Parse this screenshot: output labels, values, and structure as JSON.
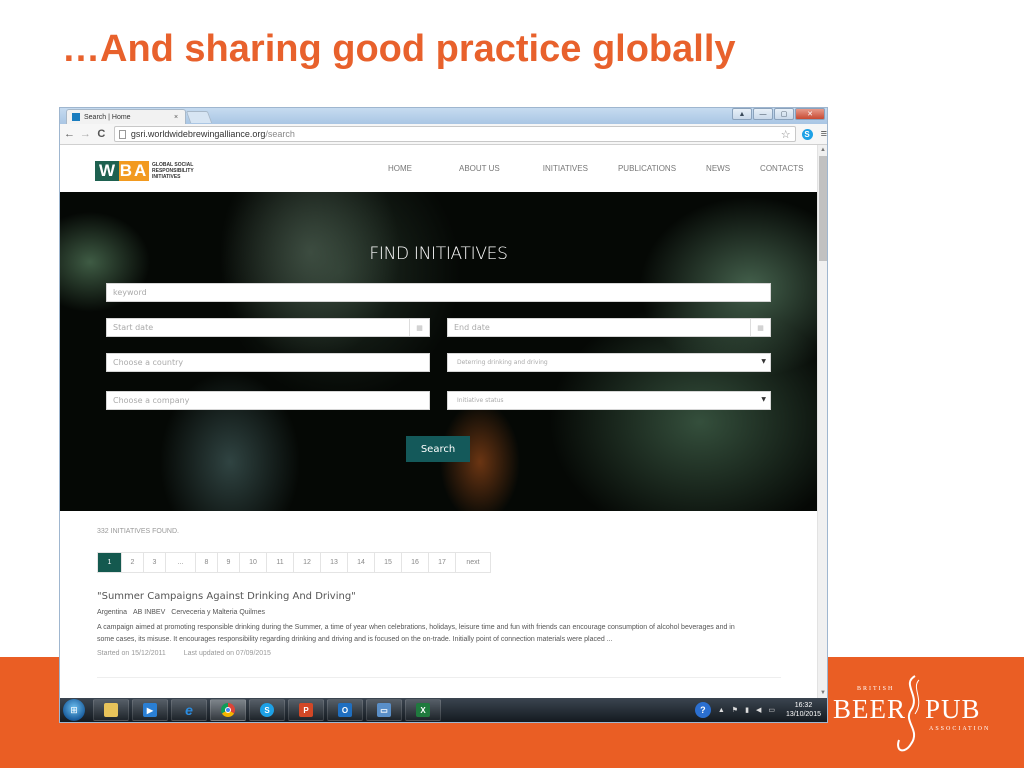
{
  "slide": {
    "title": "…And sharing good practice globally"
  },
  "browser": {
    "tab_title": "Search | Home",
    "tab_close": "×",
    "url_host": "gsri.worldwidebrewingalliance.org",
    "url_path": "/search",
    "window_controls": {
      "special": "▲",
      "minimize": "—",
      "maximize": "▢",
      "close": "✕"
    },
    "nav": {
      "back": "←",
      "forward": "→",
      "reload": "C"
    },
    "star": "☆",
    "extension": "S",
    "menu": "≡"
  },
  "site": {
    "logo": {
      "w": "W",
      "ba": "BA",
      "text": "GLOBAL SOCIAL RESPONSIBILITY INITIATIVES"
    },
    "nav": [
      "HOME",
      "ABOUT US",
      "INITIATIVES",
      "PUBLICATIONS",
      "NEWS",
      "CONTACTS"
    ],
    "hero_title": "FIND INITIATIVES",
    "form": {
      "keyword_placeholder": "keyword",
      "start_date_placeholder": "Start date",
      "end_date_placeholder": "End date",
      "country_placeholder": "Choose a country",
      "type_selected": "Deterring drinking and driving",
      "company_placeholder": "Choose a company",
      "status_selected": "Initiative status",
      "search_label": "Search"
    },
    "results_count": "332 INITIATIVES FOUND.",
    "pagination": [
      "1",
      "2",
      "3",
      "...",
      "8",
      "9",
      "10",
      "11",
      "12",
      "13",
      "14",
      "15",
      "16",
      "17",
      "next"
    ],
    "pagination_active": "1",
    "result": {
      "title": "\"Summer Campaigns Against Drinking And Driving\"",
      "country": "Argentina",
      "company": "AB INBEV",
      "brewery": "Cerveceria y Malteria Quilmes",
      "description": "A campaign aimed at promoting responsible drinking during the Summer, a time of year when celebrations, holidays, leisure time and fun with friends can encourage consumption of alcohol beverages and in some cases, its misuse. It encourages responsibility regarding drinking and driving and is focused on the on-trade. Initially point of connection materials were placed ...",
      "started": "Started on 15/12/2011",
      "updated": "Last updated on 07/09/2015"
    }
  },
  "taskbar": {
    "apps": [
      "file-explorer",
      "media-player",
      "internet-explorer",
      "chrome",
      "skype",
      "powerpoint",
      "outlook",
      "remote-desktop",
      "excel"
    ],
    "active_app": "chrome",
    "clock_time": "16:32",
    "clock_date": "13/10/2015"
  },
  "branding": {
    "small": "BRITISH",
    "beer": "BEER",
    "pub": "PUB",
    "assoc": "ASSOCIATION"
  },
  "colors": {
    "accent_orange": "#E8612C",
    "wba_green": "#1E6150",
    "wba_orange": "#F29A1F",
    "search_button": "#14595A"
  }
}
